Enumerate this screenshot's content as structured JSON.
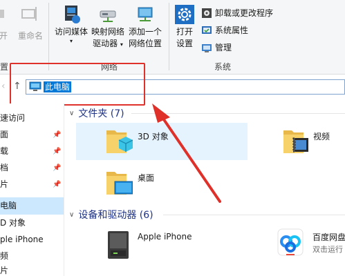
{
  "ribbon": {
    "left_buttons": [
      {
        "label": "开"
      },
      {
        "label": "重命名"
      }
    ],
    "network_buttons": [
      {
        "label1": "访问媒体",
        "label2": ""
      },
      {
        "label1": "映射网络",
        "label2": "驱动器"
      },
      {
        "label1": "添加一个",
        "label2": "网络位置"
      }
    ],
    "open_settings": {
      "label1": "打开",
      "label2": "设置"
    },
    "system_items": [
      {
        "label": "卸载或更改程序"
      },
      {
        "label": "系统属性"
      },
      {
        "label": "管理"
      }
    ],
    "group_labels": {
      "left": "置",
      "network": "网络",
      "system": "系统"
    }
  },
  "address": {
    "current": "此电脑"
  },
  "sidebar": {
    "items": [
      {
        "label": "速访问",
        "pinned": false
      },
      {
        "label": "面",
        "pinned": true
      },
      {
        "label": "载",
        "pinned": true
      },
      {
        "label": "档",
        "pinned": true
      },
      {
        "label": "片",
        "pinned": true
      },
      {
        "label": "电脑",
        "pinned": false,
        "selected": true
      },
      {
        "label": "D 对象",
        "pinned": false
      },
      {
        "label": "ple iPhone",
        "pinned": false
      },
      {
        "label": "频",
        "pinned": false
      },
      {
        "label": "片",
        "pinned": false
      }
    ]
  },
  "sections": {
    "folders": {
      "title": "文件夹 (7)"
    },
    "devices": {
      "title": "设备和驱动器 (6)"
    }
  },
  "folders": [
    {
      "label": "3D 对象"
    },
    {
      "label": "视频"
    },
    {
      "label": "桌面"
    }
  ],
  "devices": [
    {
      "label": "Apple iPhone",
      "sub": ""
    },
    {
      "label": "百度网盘",
      "sub": "双击运行"
    }
  ],
  "colors": {
    "accent": "#0078d7",
    "annotation_red": "#e0302a",
    "section_title": "#1e3287",
    "selection": "#cce8ff"
  }
}
